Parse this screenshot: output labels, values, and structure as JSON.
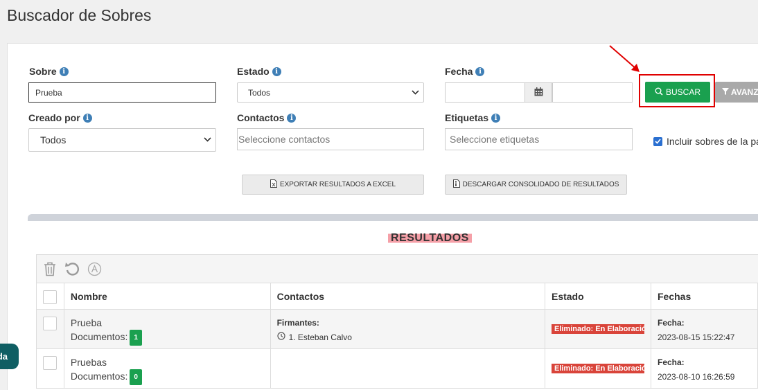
{
  "page": {
    "title": "Buscador de Sobres"
  },
  "filters": {
    "sobre": {
      "label": "Sobre",
      "value": "Prueba"
    },
    "estado": {
      "label": "Estado",
      "selected": "Todos"
    },
    "fecha": {
      "label": "Fecha",
      "from_value": "",
      "to_value": ""
    },
    "creado_por": {
      "label": "Creado por",
      "selected": "Todos"
    },
    "contactos": {
      "label": "Contactos",
      "placeholder": "Seleccione contactos"
    },
    "etiquetas": {
      "label": "Etiquetas",
      "placeholder": "Seleccione etiquetas"
    },
    "incluir": {
      "label": "Incluir sobres de la pa",
      "checked": true
    }
  },
  "buttons": {
    "buscar": "BUSCAR",
    "avanzada": "AVANZ",
    "exportar": "EXPORTAR RESULTADOS A EXCEL",
    "descargar": "DESCARGAR CONSOLIDADO DE RESULTADOS"
  },
  "results": {
    "title": "RESULTADOS",
    "columns": [
      "Nombre",
      "Contactos",
      "Estado",
      "Fechas"
    ],
    "rows": [
      {
        "name": "Prueba",
        "docs_label": "Documentos:",
        "docs_count": "1",
        "contacts_title": "Firmantes:",
        "contact": "1. Esteban Calvo",
        "status": "Eliminado: En Elaboració",
        "date_label": "Fecha:",
        "date": "2023-08-15 15:22:47"
      },
      {
        "name": "Pruebas",
        "docs_label": "Documentos:",
        "docs_count": "0",
        "contacts_title": "",
        "contact": "",
        "status": "Eliminado: En Elaboració",
        "date_label": "Fecha:",
        "date": "2023-08-10 16:26:59"
      }
    ]
  },
  "help": {
    "label": "da"
  },
  "colors": {
    "primary_green": "#1aa04f",
    "danger_red": "#d9443a",
    "info_blue": "#3f7fb6",
    "highlight_red": "#e00000"
  }
}
